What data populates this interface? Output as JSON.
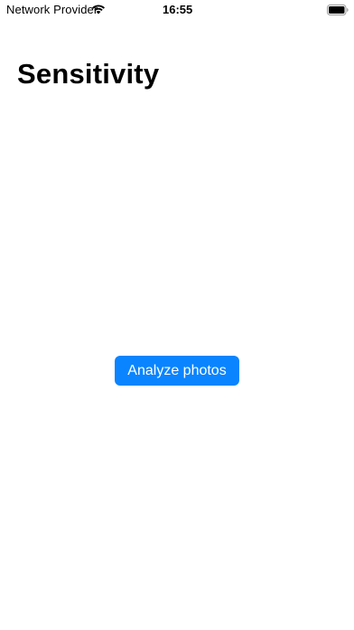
{
  "status_bar": {
    "carrier": "Network Provider",
    "wifi_icon": "wifi-icon",
    "time": "16:55",
    "battery_icon": "battery-full-icon"
  },
  "page": {
    "title": "Sensitivity"
  },
  "actions": {
    "analyze_label": "Analyze photos"
  },
  "colors": {
    "accent": "#0a84ff",
    "background": "#ffffff",
    "text": "#000000"
  }
}
